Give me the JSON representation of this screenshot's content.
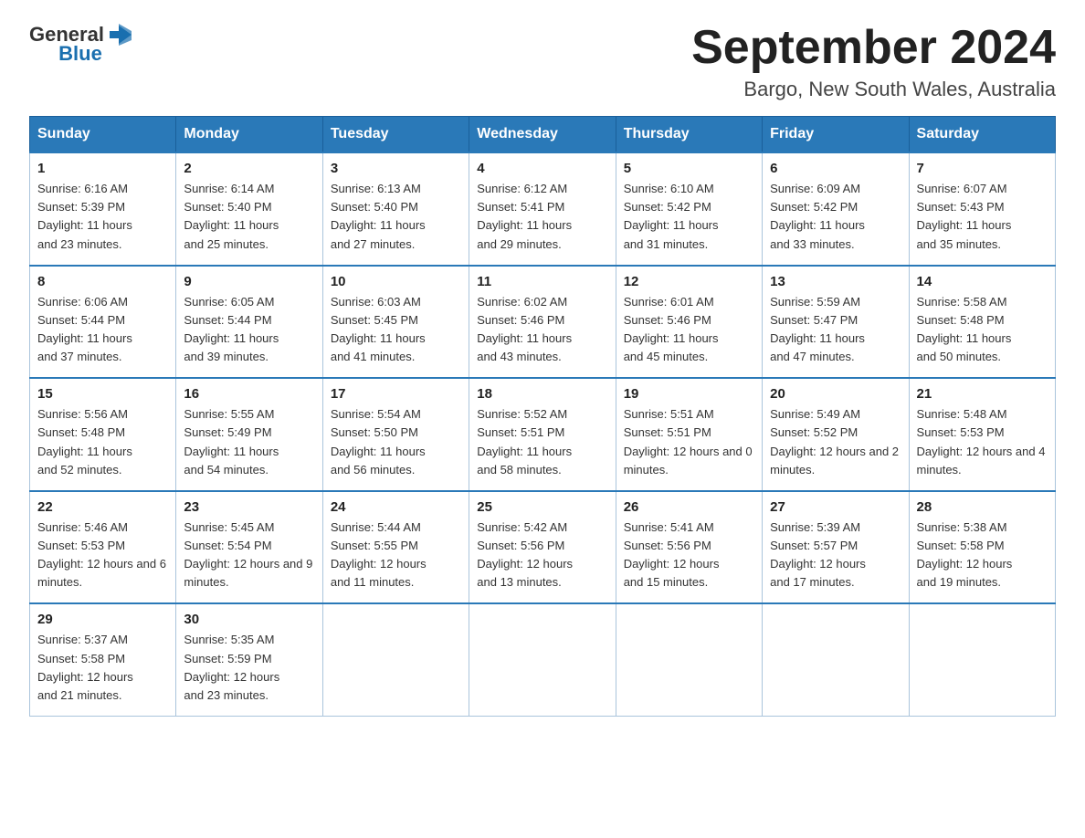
{
  "logo": {
    "text_general": "General",
    "text_blue": "Blue"
  },
  "title": "September 2024",
  "location": "Bargo, New South Wales, Australia",
  "days_of_week": [
    "Sunday",
    "Monday",
    "Tuesday",
    "Wednesday",
    "Thursday",
    "Friday",
    "Saturday"
  ],
  "weeks": [
    [
      {
        "day": "1",
        "sunrise": "6:16 AM",
        "sunset": "5:39 PM",
        "daylight": "11 hours and 23 minutes."
      },
      {
        "day": "2",
        "sunrise": "6:14 AM",
        "sunset": "5:40 PM",
        "daylight": "11 hours and 25 minutes."
      },
      {
        "day": "3",
        "sunrise": "6:13 AM",
        "sunset": "5:40 PM",
        "daylight": "11 hours and 27 minutes."
      },
      {
        "day": "4",
        "sunrise": "6:12 AM",
        "sunset": "5:41 PM",
        "daylight": "11 hours and 29 minutes."
      },
      {
        "day": "5",
        "sunrise": "6:10 AM",
        "sunset": "5:42 PM",
        "daylight": "11 hours and 31 minutes."
      },
      {
        "day": "6",
        "sunrise": "6:09 AM",
        "sunset": "5:42 PM",
        "daylight": "11 hours and 33 minutes."
      },
      {
        "day": "7",
        "sunrise": "6:07 AM",
        "sunset": "5:43 PM",
        "daylight": "11 hours and 35 minutes."
      }
    ],
    [
      {
        "day": "8",
        "sunrise": "6:06 AM",
        "sunset": "5:44 PM",
        "daylight": "11 hours and 37 minutes."
      },
      {
        "day": "9",
        "sunrise": "6:05 AM",
        "sunset": "5:44 PM",
        "daylight": "11 hours and 39 minutes."
      },
      {
        "day": "10",
        "sunrise": "6:03 AM",
        "sunset": "5:45 PM",
        "daylight": "11 hours and 41 minutes."
      },
      {
        "day": "11",
        "sunrise": "6:02 AM",
        "sunset": "5:46 PM",
        "daylight": "11 hours and 43 minutes."
      },
      {
        "day": "12",
        "sunrise": "6:01 AM",
        "sunset": "5:46 PM",
        "daylight": "11 hours and 45 minutes."
      },
      {
        "day": "13",
        "sunrise": "5:59 AM",
        "sunset": "5:47 PM",
        "daylight": "11 hours and 47 minutes."
      },
      {
        "day": "14",
        "sunrise": "5:58 AM",
        "sunset": "5:48 PM",
        "daylight": "11 hours and 50 minutes."
      }
    ],
    [
      {
        "day": "15",
        "sunrise": "5:56 AM",
        "sunset": "5:48 PM",
        "daylight": "11 hours and 52 minutes."
      },
      {
        "day": "16",
        "sunrise": "5:55 AM",
        "sunset": "5:49 PM",
        "daylight": "11 hours and 54 minutes."
      },
      {
        "day": "17",
        "sunrise": "5:54 AM",
        "sunset": "5:50 PM",
        "daylight": "11 hours and 56 minutes."
      },
      {
        "day": "18",
        "sunrise": "5:52 AM",
        "sunset": "5:51 PM",
        "daylight": "11 hours and 58 minutes."
      },
      {
        "day": "19",
        "sunrise": "5:51 AM",
        "sunset": "5:51 PM",
        "daylight": "12 hours and 0 minutes."
      },
      {
        "day": "20",
        "sunrise": "5:49 AM",
        "sunset": "5:52 PM",
        "daylight": "12 hours and 2 minutes."
      },
      {
        "day": "21",
        "sunrise": "5:48 AM",
        "sunset": "5:53 PM",
        "daylight": "12 hours and 4 minutes."
      }
    ],
    [
      {
        "day": "22",
        "sunrise": "5:46 AM",
        "sunset": "5:53 PM",
        "daylight": "12 hours and 6 minutes."
      },
      {
        "day": "23",
        "sunrise": "5:45 AM",
        "sunset": "5:54 PM",
        "daylight": "12 hours and 9 minutes."
      },
      {
        "day": "24",
        "sunrise": "5:44 AM",
        "sunset": "5:55 PM",
        "daylight": "12 hours and 11 minutes."
      },
      {
        "day": "25",
        "sunrise": "5:42 AM",
        "sunset": "5:56 PM",
        "daylight": "12 hours and 13 minutes."
      },
      {
        "day": "26",
        "sunrise": "5:41 AM",
        "sunset": "5:56 PM",
        "daylight": "12 hours and 15 minutes."
      },
      {
        "day": "27",
        "sunrise": "5:39 AM",
        "sunset": "5:57 PM",
        "daylight": "12 hours and 17 minutes."
      },
      {
        "day": "28",
        "sunrise": "5:38 AM",
        "sunset": "5:58 PM",
        "daylight": "12 hours and 19 minutes."
      }
    ],
    [
      {
        "day": "29",
        "sunrise": "5:37 AM",
        "sunset": "5:58 PM",
        "daylight": "12 hours and 21 minutes."
      },
      {
        "day": "30",
        "sunrise": "5:35 AM",
        "sunset": "5:59 PM",
        "daylight": "12 hours and 23 minutes."
      },
      null,
      null,
      null,
      null,
      null
    ]
  ],
  "labels": {
    "sunrise": "Sunrise:",
    "sunset": "Sunset:",
    "daylight": "Daylight:"
  }
}
